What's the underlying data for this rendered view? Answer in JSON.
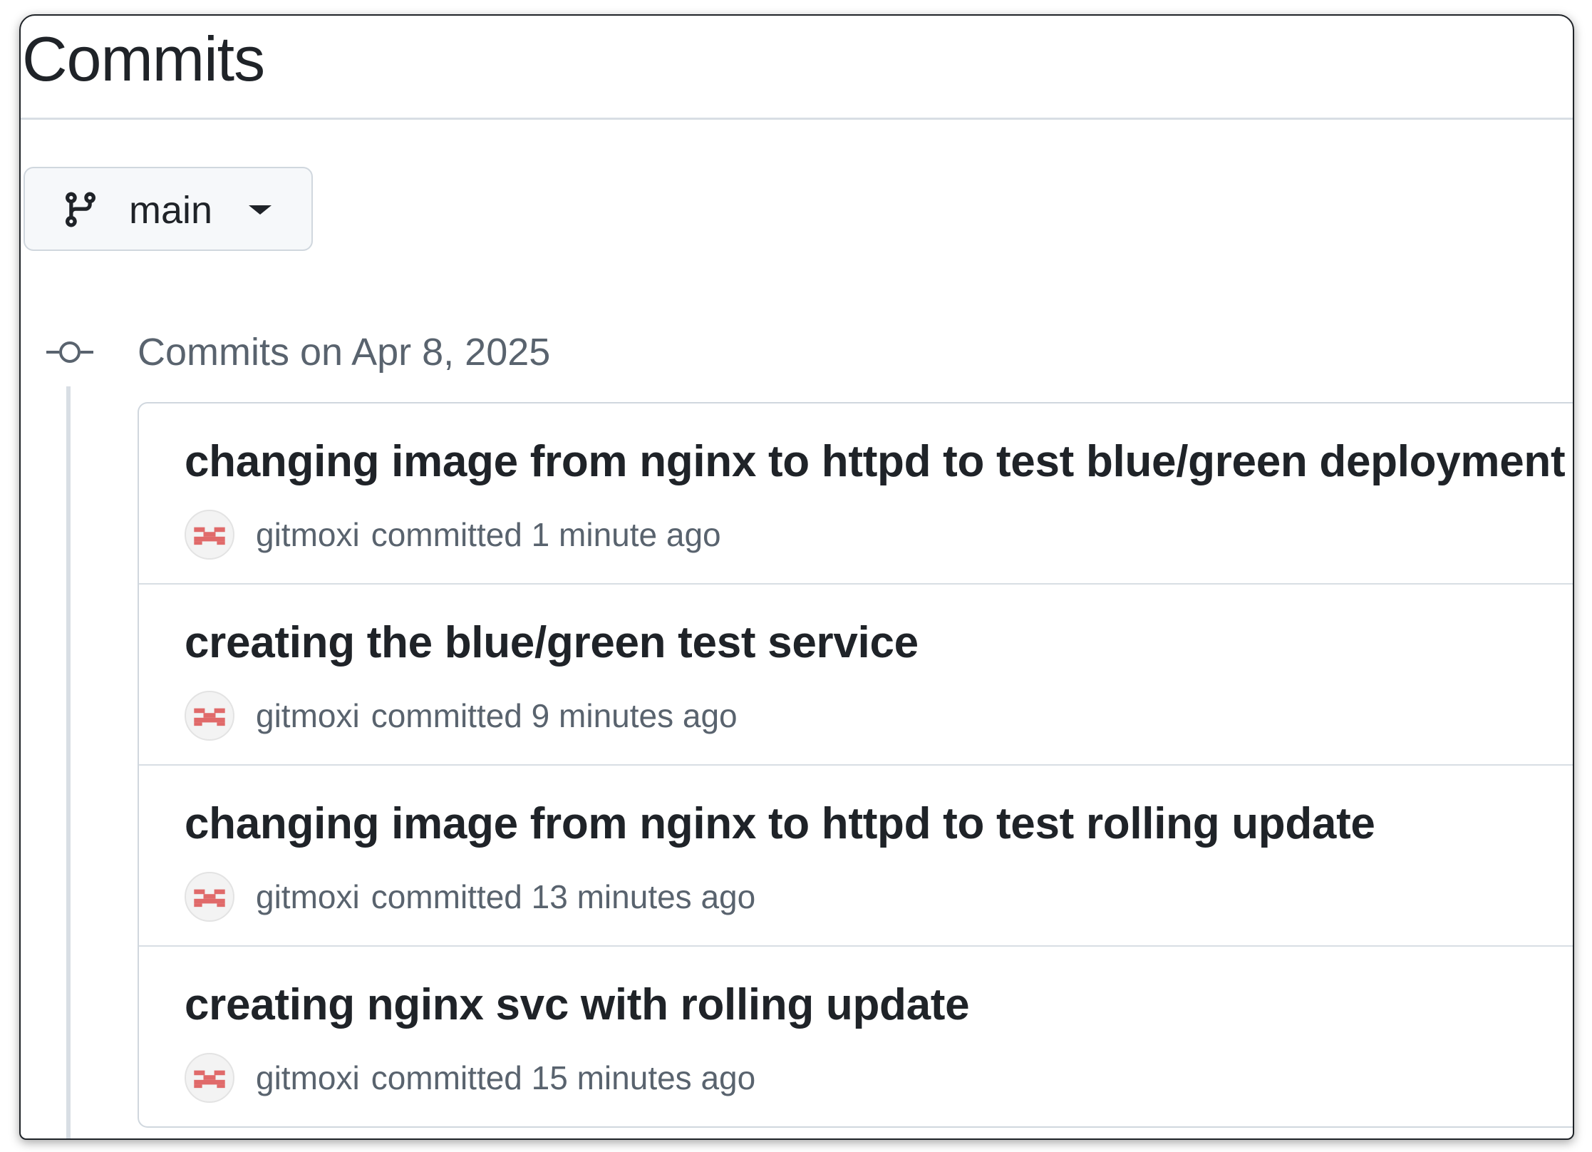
{
  "header": {
    "title": "Commits"
  },
  "branch_selector": {
    "label": "main",
    "icon": "git-branch-icon"
  },
  "commit_group": {
    "heading": "Commits on Apr 8, 2025",
    "icon": "git-commit-icon"
  },
  "commits": [
    {
      "message": "changing image from nginx to httpd to test blue/green deployment",
      "author": "gitmoxi",
      "committed_text": "committed 1 minute ago"
    },
    {
      "message": "creating the blue/green test service",
      "author": "gitmoxi",
      "committed_text": "committed 9 minutes ago"
    },
    {
      "message": "changing image from nginx to httpd to test rolling update",
      "author": "gitmoxi",
      "committed_text": "committed 13 minutes ago"
    },
    {
      "message": "creating nginx svc with rolling update",
      "author": "gitmoxi",
      "committed_text": "committed 15 minutes ago"
    }
  ],
  "colors": {
    "text_primary": "#1f2328",
    "text_muted": "#59636e",
    "border": "#d0d7de",
    "avatar_accent": "#e06a6a"
  }
}
